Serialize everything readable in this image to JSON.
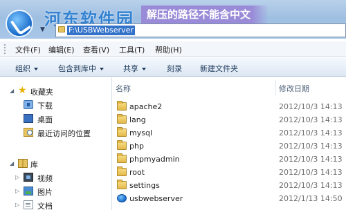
{
  "window": {
    "watermark": "河东软件园",
    "banner": "解压的路径不能含中文",
    "address_path": "F:\\USBWebserver"
  },
  "menu": [
    {
      "label": "文件(F)"
    },
    {
      "label": "编辑(E)"
    },
    {
      "label": "查看(V)"
    },
    {
      "label": "工具(T)"
    },
    {
      "label": "帮助(H)"
    }
  ],
  "toolbar": {
    "organize": "组织",
    "include_library": "包含到库中",
    "share": "共享",
    "burn": "刻录",
    "new_folder": "新建文件夹"
  },
  "nav": {
    "favorites": "收藏夹",
    "downloads": "下载",
    "desktop": "桌面",
    "recent": "最近访问的位置",
    "libraries": "库",
    "videos": "视频",
    "pictures": "图片",
    "documents": "文档"
  },
  "columns": {
    "name": "名称",
    "modified": "修改日期"
  },
  "files": [
    {
      "name": "apache2",
      "date": "2012/10/3 14:13",
      "icon": "folder-icon"
    },
    {
      "name": "lang",
      "date": "2012/10/3 14:13",
      "icon": "folder-icon"
    },
    {
      "name": "mysql",
      "date": "2012/10/3 14:13",
      "icon": "folder-icon"
    },
    {
      "name": "php",
      "date": "2012/10/3 14:13",
      "icon": "folder-icon"
    },
    {
      "name": "phpmyadmin",
      "date": "2012/10/3 14:13",
      "icon": "folder-icon"
    },
    {
      "name": "root",
      "date": "2012/10/3 14:13",
      "icon": "folder-icon"
    },
    {
      "name": "settings",
      "date": "2012/10/3 14:13",
      "icon": "folder-icon"
    },
    {
      "name": "usbwebserver",
      "date": "2012/1/13 14:50",
      "icon": "application-icon"
    }
  ]
}
